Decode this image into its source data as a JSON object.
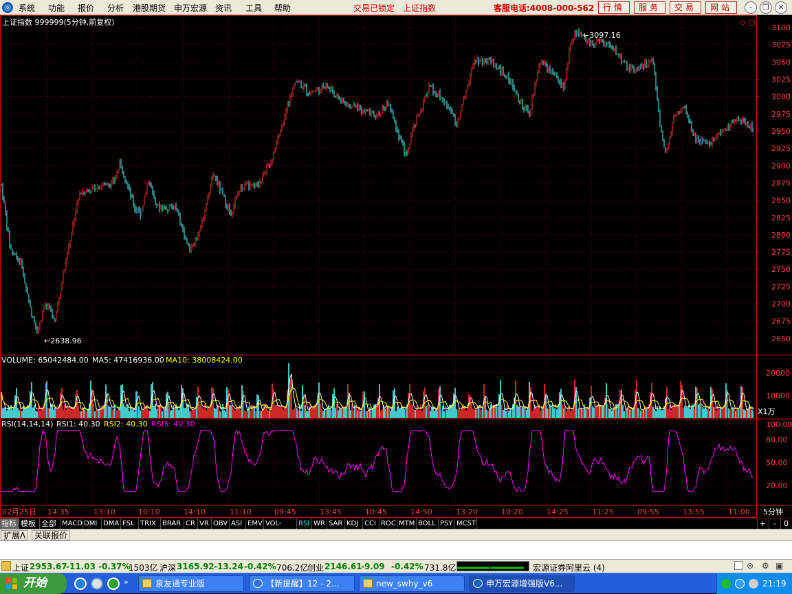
{
  "menu": {
    "items": [
      "系统",
      "功能",
      "报价",
      "分析",
      "港股期货",
      "申万宏源",
      "资讯",
      "工具",
      "帮助"
    ],
    "lock_status": "交易已锁定",
    "index_link": "上证指数",
    "phone": "客服电话:4008-000-562",
    "buttons": [
      "行情",
      "服务",
      "交易",
      "网站"
    ]
  },
  "chart": {
    "title": "上证指数 999999(5分钟,前复权)",
    "high_label": "3097.16",
    "low_label": "2638.96",
    "price_ticks": [
      "3100",
      "3075",
      "3050",
      "3025",
      "3000",
      "2975",
      "2950",
      "2925",
      "2900",
      "2875",
      "2850",
      "2825",
      "2800",
      "2775",
      "2750",
      "2725",
      "2700",
      "2675",
      "2650"
    ],
    "volume": {
      "label": "VOLUME: 65042484.00",
      "ma5": "MA5: 47416936.00",
      "ma10": "MA10: 38008424.00",
      "ticks": [
        "20000",
        "10000"
      ],
      "unit": "X1万"
    },
    "rsi": {
      "label": "RSI(14,14,14)",
      "rsi1": "RSI1: 40.30",
      "rsi2": "RSI2: 40.30",
      "rsi3": "RSI3: 40.30",
      "ticks": [
        "100.00",
        "80.00",
        "50.00",
        "20.00"
      ]
    },
    "time_labels": [
      "02月25日",
      "14:35",
      "13:10",
      "10:10",
      "14:10",
      "11:10",
      "09:45",
      "13:45",
      "10:45",
      "14:50",
      "13:20",
      "10:20",
      "14:25",
      "11:25",
      "09:55",
      "13:55",
      "11:00"
    ],
    "period": "5分钟"
  },
  "indicator_tabs": [
    "指标",
    "模板",
    "全部",
    "MACD",
    "DMI",
    "DMA",
    "FSL",
    "TRIX",
    "BRAR",
    "CR",
    "VR",
    "OBV",
    "ASI",
    "EMV",
    "VOL-TDX",
    "RSI",
    "WR",
    "SAR",
    "KDJ",
    "CCI",
    "ROC",
    "MTM",
    "BOLL",
    "PSY",
    "MCST"
  ],
  "selected_tab": "RSI",
  "tab_controls": [
    "+",
    "-",
    "0"
  ],
  "sub_tabs": [
    "扩展Λ",
    "关联报价"
  ],
  "status": {
    "sh_name": "上证",
    "sh_val": "2953.67",
    "sh_chg": "-11.03",
    "sh_pct": "-0.37%",
    "sh_amt": "1503亿",
    "hs_name": "沪深",
    "hs_val": "3165.92",
    "hs_chg": "-13.24",
    "hs_pct": "-0.42%",
    "hs_amt": "706.2亿",
    "cy_name": "创业",
    "cy_val": "2146.61",
    "cy_chg": "-9.09",
    "cy_pct": "-0.42%",
    "cy_amt": "731.8亿",
    "broker": "宏源证券阿里云 (4)"
  },
  "taskbar": {
    "start": "开始",
    "tasks": [
      "泉友通专业版",
      "【新提醒】12 - 2...",
      "new_swhy_v6",
      "申万宏源增强版V6..."
    ],
    "clock": "21:19"
  },
  "colors": {
    "up": "#ff3232",
    "down": "#54fcfc",
    "grid": "#800000",
    "axis": "#c00000",
    "rsi": "#ff00ff",
    "ma5": "#ffffff",
    "ma10": "#ffff00"
  }
}
